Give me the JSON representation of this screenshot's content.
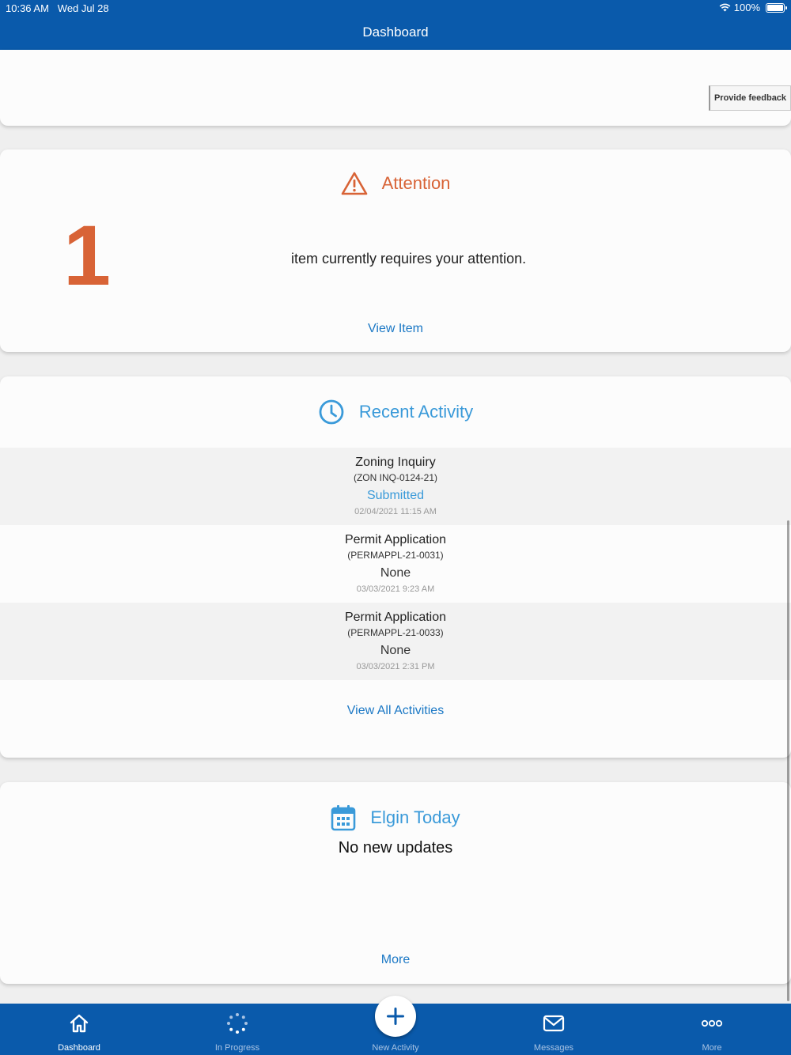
{
  "status_bar": {
    "time": "10:36 AM",
    "date": "Wed Jul 28",
    "battery": "100%"
  },
  "header": {
    "title": "Dashboard"
  },
  "feedback": {
    "label": "Provide feedback"
  },
  "attention": {
    "title": "Attention",
    "count": "1",
    "message": "item currently requires your attention.",
    "link": "View Item"
  },
  "recent_activity": {
    "title": "Recent Activity",
    "items": [
      {
        "name": "Zoning Inquiry",
        "id": "(ZON INQ-0124-21)",
        "status": "Submitted",
        "date": "02/04/2021 11:15 AM"
      },
      {
        "name": "Permit Application",
        "id": "(PERMAPPL-21-0031)",
        "status": "None",
        "date": "03/03/2021 9:23 AM"
      },
      {
        "name": "Permit Application",
        "id": "(PERMAPPL-21-0033)",
        "status": "None",
        "date": "03/03/2021 2:31 PM"
      }
    ],
    "link": "View All Activities"
  },
  "today": {
    "title": "Elgin Today",
    "message": "No new updates",
    "link": "More"
  },
  "tabs": [
    {
      "label": "Dashboard",
      "icon": "home-icon"
    },
    {
      "label": "In Progress",
      "icon": "spinner-icon"
    },
    {
      "label": "New Activity",
      "icon": "plus-icon"
    },
    {
      "label": "Messages",
      "icon": "envelope-icon"
    },
    {
      "label": "More",
      "icon": "ellipsis-icon"
    }
  ],
  "colors": {
    "brand": "#0a5aab",
    "attention": "#d86336",
    "link": "#1b78c5",
    "section": "#3a9ad9"
  }
}
